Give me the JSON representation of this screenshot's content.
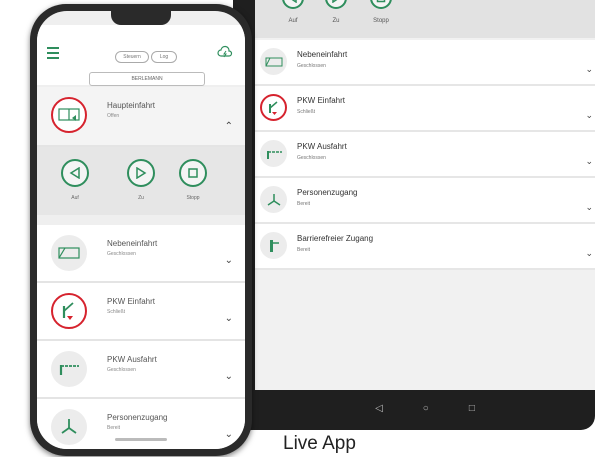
{
  "tablet": {
    "controls": [
      {
        "label": "Auf"
      },
      {
        "label": "Zu"
      },
      {
        "label": "Stopp"
      }
    ],
    "items": [
      {
        "title": "Nebeneinfahrt",
        "status": "Geschlossen"
      },
      {
        "title": "PKW Einfahrt",
        "status": "Schließt"
      },
      {
        "title": "PKW Ausfahrt",
        "status": "Geschlossen"
      },
      {
        "title": "Personenzugang",
        "status": "Bereit"
      },
      {
        "title": "Barrierefreier Zugang",
        "status": "Bereit"
      }
    ],
    "nav": {
      "back": "◁",
      "home": "○",
      "recent": "□"
    }
  },
  "caption": "Live App",
  "phone": {
    "header": {
      "tab1": "Steuern",
      "tab2": "Log",
      "location": "BERLEMANN"
    },
    "open_item": {
      "title": "Haupteinfahrt",
      "status": "Offen"
    },
    "controls": [
      {
        "label": "Auf"
      },
      {
        "label": "Zu"
      },
      {
        "label": "Stopp"
      }
    ],
    "items": [
      {
        "title": "Nebeneinfahrt",
        "status": "Geschlossen"
      },
      {
        "title": "PKW Einfahrt",
        "status": "Schließt"
      },
      {
        "title": "PKW Ausfahrt",
        "status": "Geschlossen"
      },
      {
        "title": "Personenzugang",
        "status": "Bereit"
      }
    ]
  },
  "colors": {
    "accent": "#2f8e5d",
    "alert": "#d6232e"
  }
}
